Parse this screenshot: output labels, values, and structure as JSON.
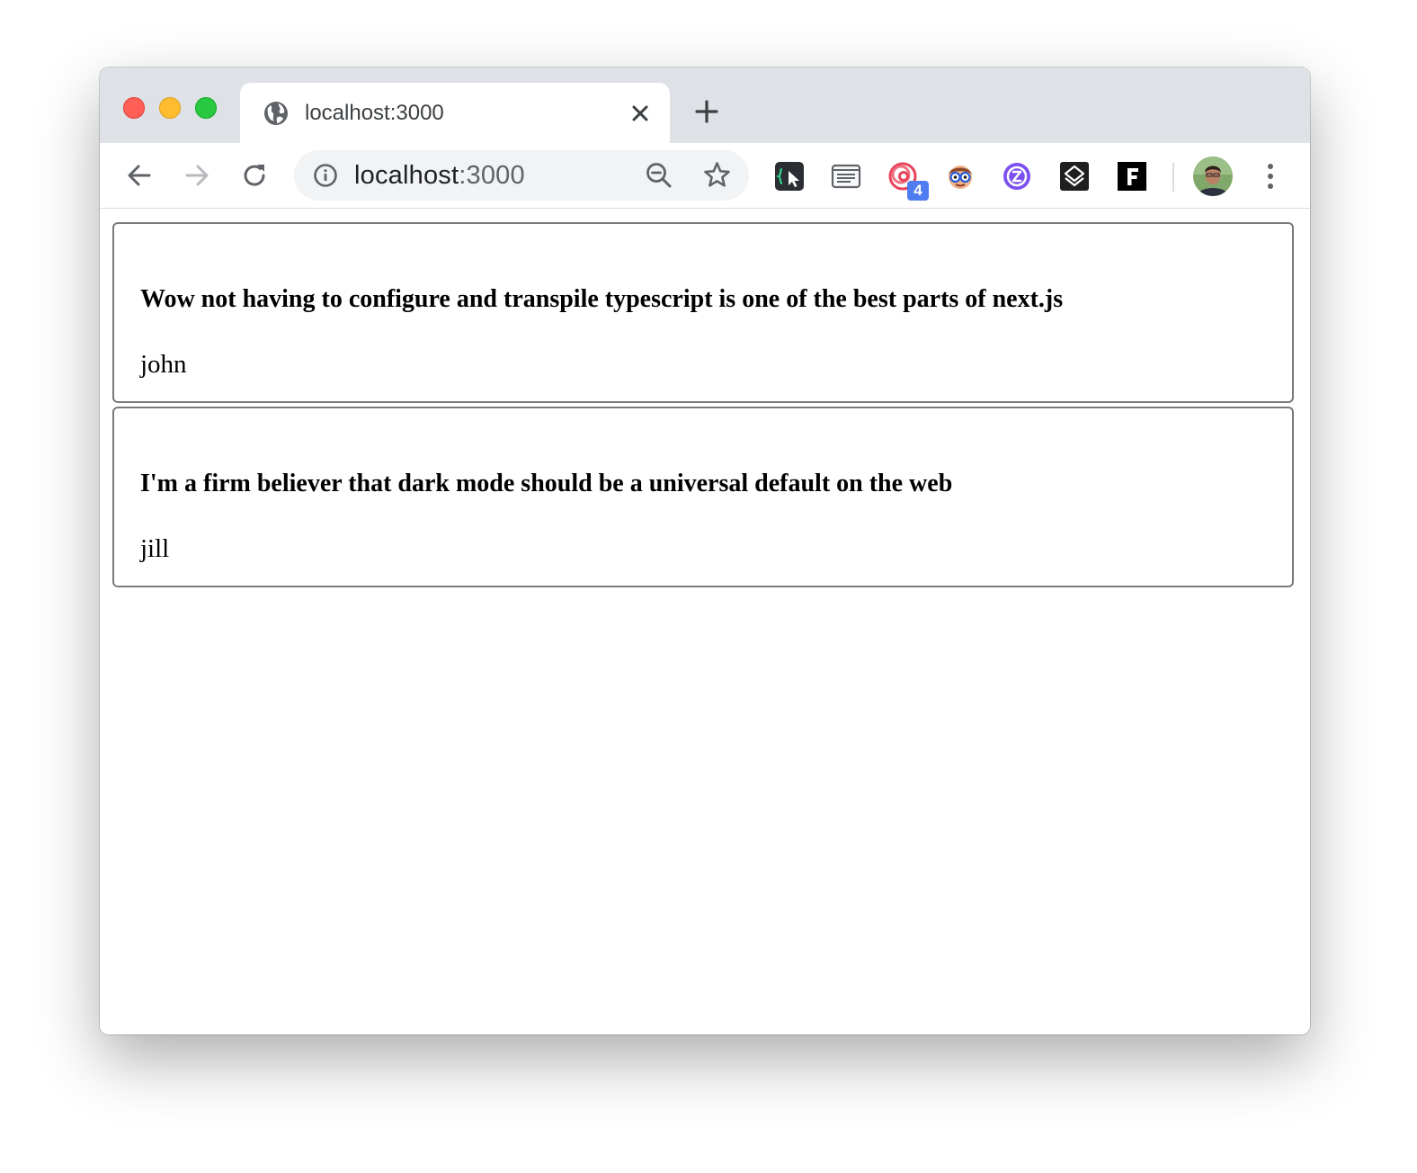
{
  "browser": {
    "tab": {
      "title": "localhost:3000",
      "favicon": "globe-icon",
      "close": "close-icon"
    },
    "new_tab": "plus-icon",
    "nav": {
      "back": "back-arrow-icon",
      "forward": "forward-arrow-icon",
      "reload": "reload-icon"
    },
    "omnibox": {
      "host": "localhost",
      "port": ":3000",
      "info": "info-icon",
      "zoom": "zoom-out-icon",
      "bookmark": "star-icon"
    },
    "extensions": [
      {
        "name": "code-cursor-extension-icon"
      },
      {
        "name": "reader-extension-icon"
      },
      {
        "name": "swirl-extension-icon",
        "badge": "4"
      },
      {
        "name": "nerd-glasses-extension-icon"
      },
      {
        "name": "purple-circle-extension-icon"
      },
      {
        "name": "layers-extension-icon"
      },
      {
        "name": "f-extension-icon"
      }
    ],
    "profile": "profile-avatar",
    "menu": "three-dot-menu-icon"
  },
  "posts": [
    {
      "title": "Wow not having to configure and transpile typescript is one of the best parts of next.js",
      "author": "john"
    },
    {
      "title": "I'm a firm believer that dark mode should be a universal default on the web",
      "author": "jill"
    }
  ],
  "colors": {
    "tabstrip": "#dee1e6",
    "omnibox": "#f1f3f4",
    "card_border": "#7a7a7a",
    "badge": "#4f7cf0"
  }
}
